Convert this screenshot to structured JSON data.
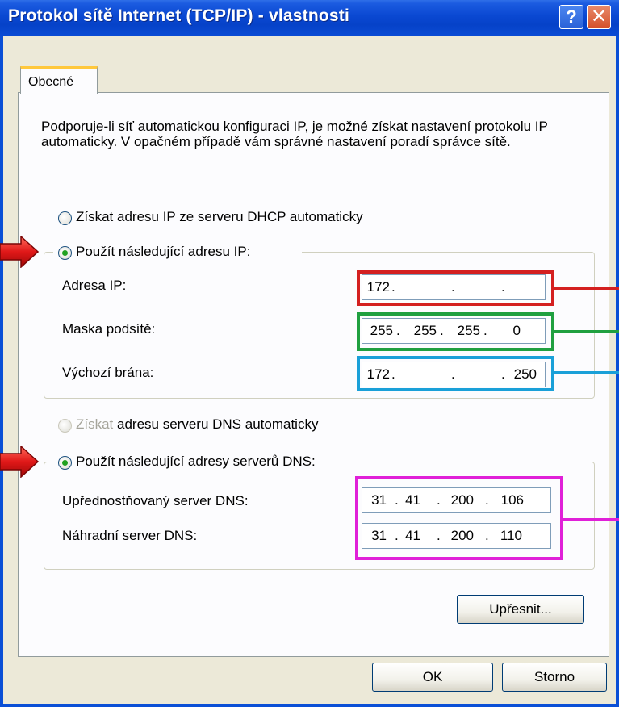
{
  "window": {
    "title": "Protokol sítě Internet (TCP/IP) - vlastnosti",
    "help_glyph": "?",
    "close_glyph": "✕"
  },
  "tabs": [
    {
      "label": "Obecné"
    }
  ],
  "intro_text": "Podporuje-li síť automatickou konfiguraci IP, je možné získat nastavení protokolu IP automaticky. V opačném případě vám správné nastavení poradí správce sítě.",
  "ip_section": {
    "radio_auto": {
      "label": "Získat adresu IP ze serveru DHCP automaticky",
      "selected": false
    },
    "radio_manual": {
      "label": "Použít následující adresu IP:",
      "selected": true
    },
    "fields": [
      {
        "label": "Adresa IP:",
        "octets": [
          "172",
          "",
          "",
          ""
        ]
      },
      {
        "label": "Maska podsítě:",
        "octets": [
          "255",
          "255",
          "255",
          "0"
        ]
      },
      {
        "label": "Výchozí brána:",
        "octets": [
          "172",
          "",
          "",
          "250"
        ]
      }
    ]
  },
  "dns_section": {
    "radio_auto": {
      "label_grey": "Získat",
      "label_rest": " adresu serveru DNS automaticky",
      "selected": false,
      "disabled": true
    },
    "radio_manual": {
      "label": "Použít následující adresy serverů DNS:",
      "selected": true
    },
    "fields": [
      {
        "label": "Upřednostňovaný server DNS:",
        "octets": [
          "31",
          "41",
          "200",
          "106"
        ]
      },
      {
        "label": "Náhradní server DNS:",
        "octets": [
          "31",
          "41",
          "200",
          "110"
        ]
      }
    ]
  },
  "buttons": {
    "advanced": "Upřesnit...",
    "ok": "OK",
    "cancel": "Storno"
  },
  "colors": {
    "ip_highlight": "#d42020",
    "mask_highlight": "#20a040",
    "gateway_highlight": "#1aa0d8",
    "dns_highlight": "#e020d8",
    "arrow": "#e01818"
  }
}
